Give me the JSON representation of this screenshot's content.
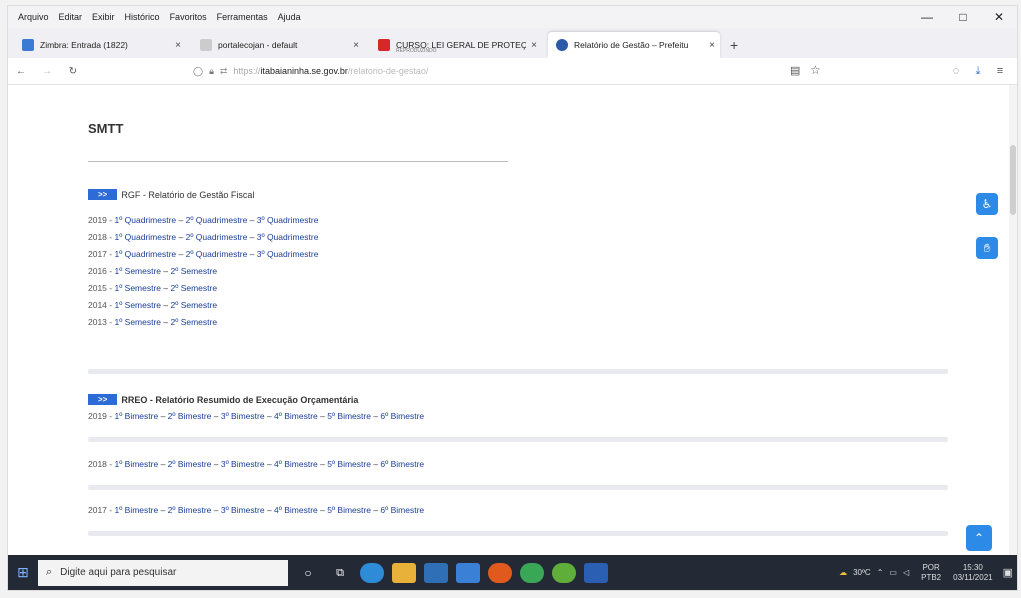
{
  "menubar": {
    "items": [
      "Arquivo",
      "Editar",
      "Exibir",
      "Histórico",
      "Favoritos",
      "Ferramentas",
      "Ajuda"
    ]
  },
  "window_controls": {
    "minimize": "—",
    "maximize": "□",
    "close": "✕"
  },
  "tabs": [
    {
      "label": "Zimbra: Entrada (1822)",
      "icon_color": "#3b7bd4",
      "active": false
    },
    {
      "label": "portalecojan - default",
      "icon_color": "#cccccc",
      "active": false
    },
    {
      "label": "CURSO: LEI GERAL DE PROTEÇ",
      "sublabel": "REPRODUZINDO",
      "icon_color": "#d62828",
      "active": false
    },
    {
      "label": "Relatório de Gestão – Prefeitu",
      "icon_color": "#2a5aa8",
      "active": true
    }
  ],
  "tab_close_glyph": "×",
  "new_tab_glyph": "+",
  "navbar": {
    "url_scheme": "https://",
    "url_domain": "itabaianinha.se.gov.br",
    "url_path": "/relatorio-de-gestao/"
  },
  "page": {
    "title": "SMTT",
    "rgf": {
      "badge": ">>",
      "heading": "RGF - Relatório de Gestão Fiscal",
      "rows": [
        {
          "year": "2019",
          "items": [
            "1º Quadrimestre",
            "2º Quadrimestre",
            "3º Quadrimestre"
          ]
        },
        {
          "year": "2018",
          "items": [
            "1º Quadrimestre",
            "2º Quadrimestre",
            "3º Quadrimestre"
          ]
        },
        {
          "year": "2017",
          "items": [
            "1º Quadrimestre",
            "2º Quadrimestre",
            "3º Quadrimestre"
          ]
        },
        {
          "year": "2016",
          "items": [
            "1º Semestre",
            "2º Semestre"
          ]
        },
        {
          "year": "2015",
          "items": [
            "1º Semestre",
            "2º Semestre"
          ]
        },
        {
          "year": "2014",
          "items": [
            "1º Semestre",
            "2º Semestre"
          ]
        },
        {
          "year": "2013",
          "items": [
            "1º Semestre",
            "2º Semestre"
          ]
        }
      ]
    },
    "rreo": {
      "badge": ">>",
      "heading": "RREO - Relatório Resumido de Execução Orçamentária",
      "rows": [
        {
          "year": "2019",
          "items": [
            "1º Bimestre",
            "2º Bimestre",
            "3º Bimestre",
            "4º Bimestre",
            "5º Bimestre",
            "6º Bimestre"
          ]
        },
        {
          "year": "2018",
          "items": [
            "1º Bimestre",
            "2º Bimestre",
            "3º Bimestre",
            "4º Bimestre",
            "5º Bimestre",
            "6º Bimestre"
          ]
        },
        {
          "year": "2017",
          "items": [
            "1º Bimestre",
            "2º Bimestre",
            "3º Bimestre",
            "4º Bimestre",
            "5º Bimestre",
            "6º Bimestre"
          ]
        }
      ]
    },
    "separator": " – ",
    "year_separator": " - "
  },
  "taskbar": {
    "search_placeholder": "Digite aqui para pesquisar",
    "weather": "30ºC",
    "lang_top": "POR",
    "lang_bottom": "PTB2",
    "time": "15:30",
    "date": "03/11/2021"
  },
  "colors": {
    "accent": "#2d6cd6",
    "link": "#1a3f9a",
    "taskbar": "#232a36"
  }
}
